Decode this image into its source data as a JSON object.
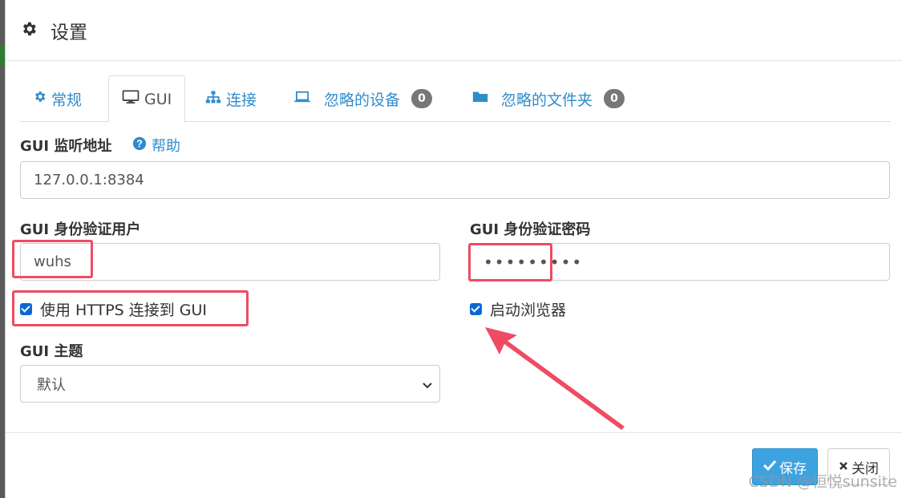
{
  "header": {
    "title": "设置"
  },
  "tabs": [
    {
      "label": "常规",
      "icon": "gear-icon"
    },
    {
      "label": "GUI",
      "icon": "monitor-icon"
    },
    {
      "label": "连接",
      "icon": "sitemap-icon"
    },
    {
      "label": "忽略的设备",
      "icon": "laptop-icon",
      "badge": "0"
    },
    {
      "label": "忽略的文件夹",
      "icon": "folder-icon",
      "badge": "0"
    }
  ],
  "form": {
    "listen_label": "GUI 监听地址",
    "help_label": "帮助",
    "listen_value": "127.0.0.1:8384",
    "user_label": "GUI 身份验证用户",
    "user_value": "wuhs",
    "password_label": "GUI 身份验证密码",
    "password_value": "•••••••••",
    "https_label": "使用 HTTPS 连接到 GUI",
    "https_checked": true,
    "browser_label": "启动浏览器",
    "browser_checked": true,
    "theme_label": "GUI 主题",
    "theme_value": "默认"
  },
  "footer": {
    "save_label": "保存",
    "close_label": "关闭"
  },
  "watermark": "CSDN @恒悦sunsite",
  "colors": {
    "accent": "#2f8ccc",
    "save_bg": "#3da3e0",
    "highlight": "#ef4b63",
    "badge": "#777777"
  }
}
